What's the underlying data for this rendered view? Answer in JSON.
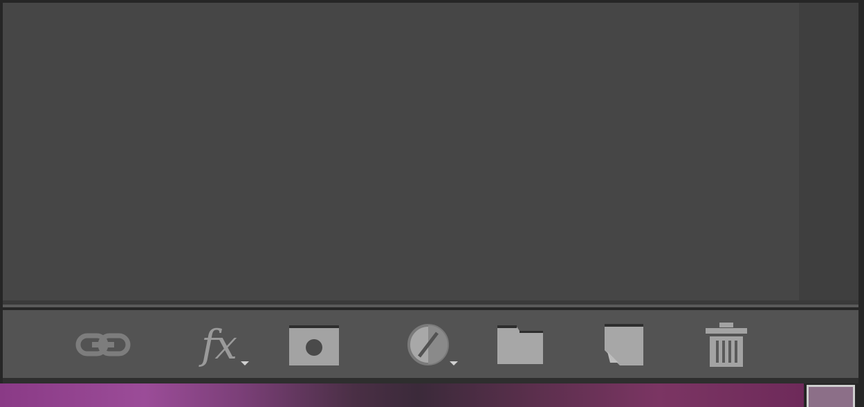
{
  "panel": {
    "name": "layers-panel"
  },
  "toolbar": {
    "buttons": [
      {
        "id": "link-layers",
        "icon": "link-icon"
      },
      {
        "id": "layer-style",
        "icon": "fx-icon",
        "label": "fx",
        "has_dropdown": true
      },
      {
        "id": "add-mask",
        "icon": "mask-icon"
      },
      {
        "id": "adjustment-layer",
        "icon": "adjustment-icon",
        "has_dropdown": true
      },
      {
        "id": "new-group",
        "icon": "folder-icon"
      },
      {
        "id": "new-layer",
        "icon": "new-layer-icon"
      },
      {
        "id": "delete-layer",
        "icon": "trash-icon"
      }
    ]
  },
  "colors": {
    "panel_bg": "#464646",
    "toolbar_bg": "#535353",
    "icon": "#9a9a9a"
  }
}
